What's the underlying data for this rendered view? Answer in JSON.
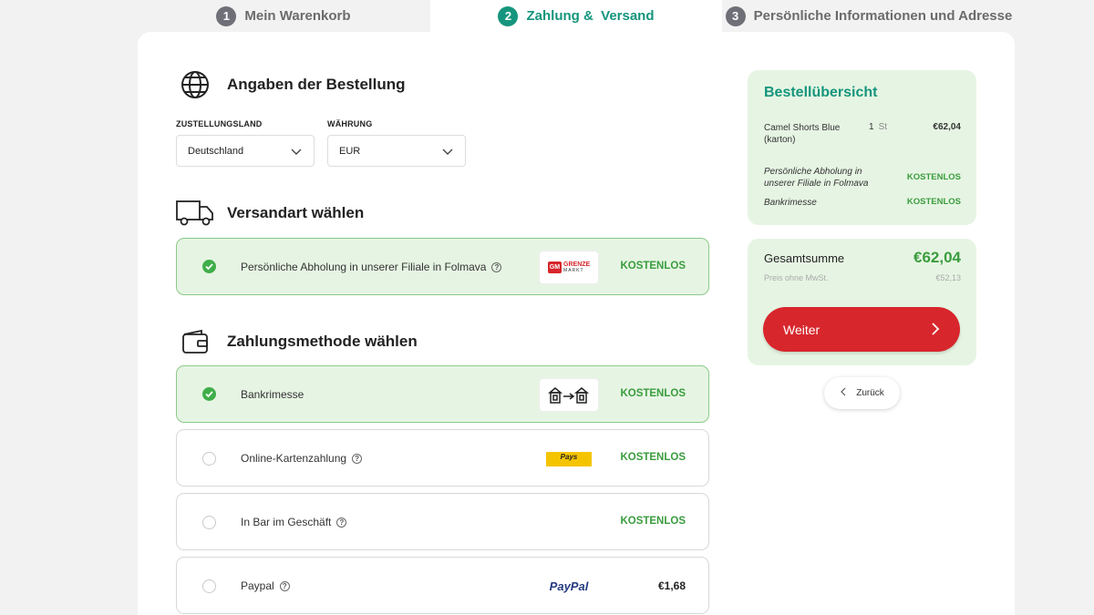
{
  "steps": [
    {
      "num": "1",
      "label": "Mein Warenkorb"
    },
    {
      "num": "2",
      "label": "Zahlung &  Versand"
    },
    {
      "num": "3",
      "label": "Persönliche Informationen und Adresse"
    }
  ],
  "order_details": {
    "title": "Angaben der Bestellung",
    "country_label": "ZUSTELLUNGSLAND",
    "country_value": "Deutschland",
    "currency_label": "WÄHRUNG",
    "currency_value": "EUR"
  },
  "shipping": {
    "title": "Versandart wählen",
    "options": [
      {
        "label": "Persönliche Abholung in unserer Filiale in Folmava",
        "price": "KOSTENLOS",
        "logo_text_1": "GM",
        "logo_text_2": "GRENZE",
        "logo_text_3": "MARKT"
      }
    ]
  },
  "payment": {
    "title": "Zahlungsmethode wählen",
    "options": [
      {
        "label": "Bankrimesse",
        "price": "KOSTENLOS"
      },
      {
        "label": "Online-Kartenzahlung",
        "price": "KOSTENLOS",
        "logo_text": "Pays"
      },
      {
        "label": "In Bar im Geschäft",
        "price": "KOSTENLOS"
      },
      {
        "label": "Paypal",
        "price": "€1,68",
        "logo_text": "PayPal"
      }
    ]
  },
  "summary": {
    "title": "Bestellübersicht",
    "item_name": "Camel Shorts Blue (karton)",
    "item_qty": "1",
    "item_unit": "St",
    "item_price": "€62,04",
    "shipping_label": "Persönliche Abholung in unserer Filiale in Folmava",
    "shipping_price": "KOSTENLOS",
    "payment_label": "Bankrimesse",
    "payment_price": "KOSTENLOS"
  },
  "total": {
    "label": "Gesamtsumme",
    "value": "€62,04",
    "net_label": "Preis ohne MwSt.",
    "net_value": "€52,13",
    "continue_label": "Weiter",
    "back_label": "Zurück"
  },
  "colors": {
    "accent": "#15957d",
    "selected_bg": "#e6f5e3",
    "price_green": "#3a9c3e",
    "button_red": "#d7262c"
  }
}
